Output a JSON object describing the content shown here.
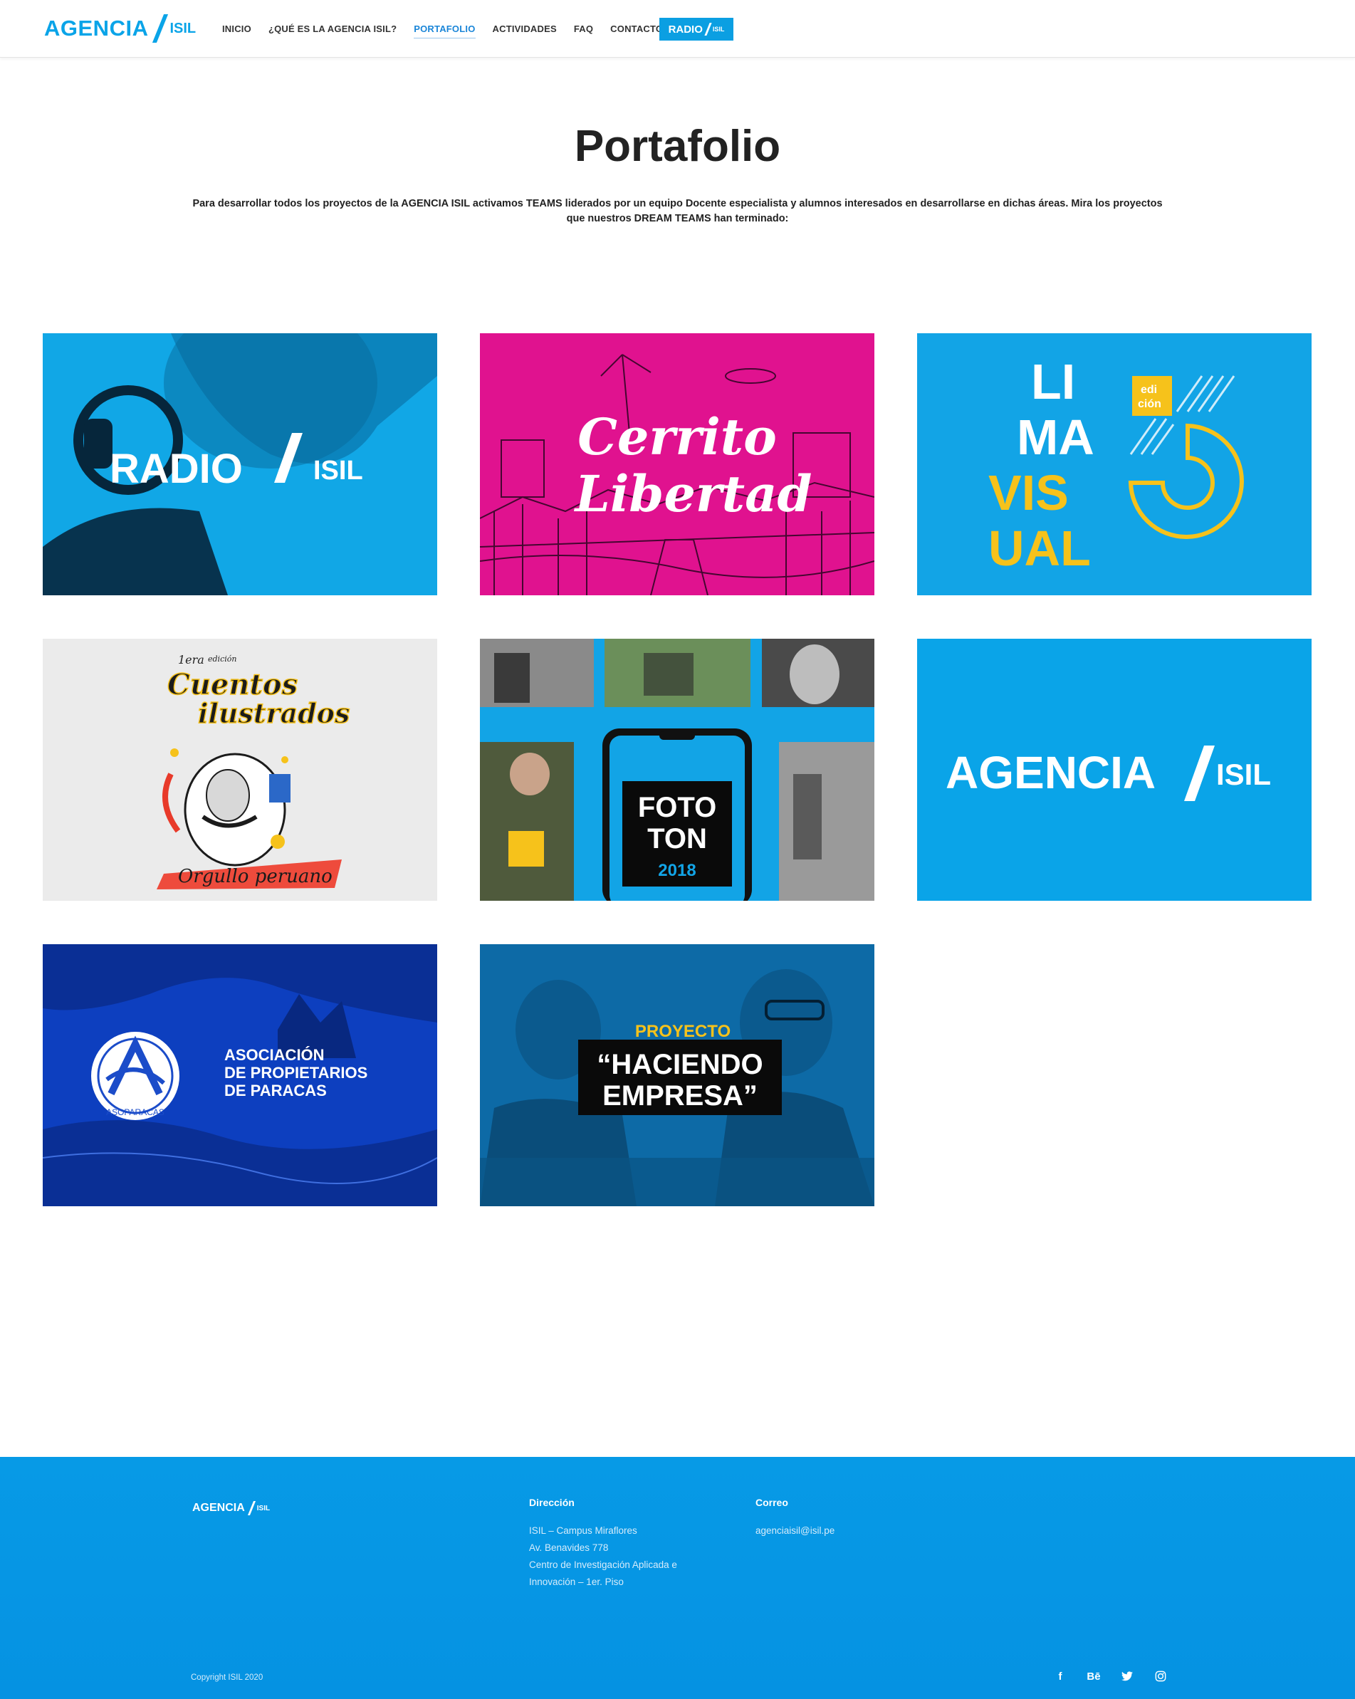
{
  "header": {
    "logo_main": "AGENCIA",
    "logo_sub": "ISIL",
    "nav": [
      {
        "label": "INICIO"
      },
      {
        "label": "¿QUÉ ES LA AGENCIA ISIL?"
      },
      {
        "label": "PORTAFOLIO",
        "active": true
      },
      {
        "label": "ACTIVIDADES"
      },
      {
        "label": "FAQ"
      },
      {
        "label": "CONTACTO"
      }
    ],
    "radio_main": "RADIO",
    "radio_sub": "ISIL"
  },
  "hero": {
    "title": "Portafolio",
    "intro": "Para desarrollar todos los proyectos de la AGENCIA ISIL activamos TEAMS liderados por un equipo Docente especialista y alumnos interesados en desarrollarse en dichas áreas. Mira los proyectos que nuestros DREAM TEAMS han terminado:"
  },
  "portfolio": [
    {
      "name": "radio-isil",
      "texts": [
        "RADIO",
        "ISIL"
      ]
    },
    {
      "name": "cerrito-libertad",
      "texts": [
        "Cerrito",
        "Libertad"
      ]
    },
    {
      "name": "lima-visual",
      "texts": [
        "LI",
        "MA",
        "VIS",
        "UAL",
        "edi",
        "ción"
      ]
    },
    {
      "name": "cuentos-ilustrados",
      "texts": [
        "1era",
        "edición",
        "Cuentos",
        "ilustrados",
        "Orgullo peruano"
      ]
    },
    {
      "name": "fototon",
      "texts": [
        "FOTO",
        "TON",
        "2018"
      ]
    },
    {
      "name": "agencia-isil",
      "texts": [
        "AGENCIA",
        "ISIL"
      ]
    },
    {
      "name": "asoparacas",
      "texts": [
        "ASOCIACIÓN",
        "DE PROPIETARIOS",
        "DE PARACAS",
        "ASOPARACAS"
      ]
    },
    {
      "name": "haciendo-empresa",
      "texts": [
        "PROYECTO",
        "“HACIENDO",
        "EMPRESA”"
      ]
    }
  ],
  "footer": {
    "logo_main": "AGENCIA",
    "logo_sub": "ISIL",
    "address_title": "Dirección",
    "address_lines": [
      "ISIL – Campus Miraflores",
      "Av. Benavides 778",
      "Centro de Investigación Aplicada e",
      "Innovación – 1er. Piso"
    ],
    "email_title": "Correo",
    "email": "agenciaisil@isil.pe",
    "copyright": "Copyright ISIL 2020",
    "social": [
      {
        "icon": "facebook-icon",
        "glyph": "f"
      },
      {
        "icon": "behance-icon",
        "glyph": "Bē"
      },
      {
        "icon": "twitter-icon",
        "glyph": "🐦"
      },
      {
        "icon": "instagram-icon",
        "glyph": "◎"
      }
    ]
  },
  "colors": {
    "accent": "#0aa4e8",
    "link_active": "#1b86d8",
    "footer_bg": "#0797e4",
    "magenta": "#e0128f",
    "yellow": "#f6c21b"
  }
}
